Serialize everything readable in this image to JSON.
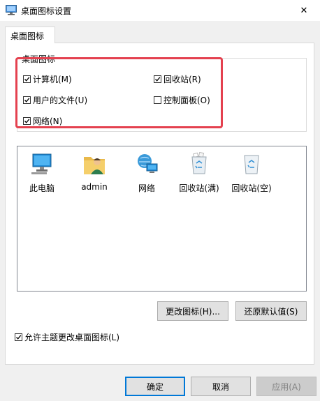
{
  "window": {
    "title": "桌面图标设置",
    "close_symbol": "✕"
  },
  "tab": {
    "label": "桌面图标"
  },
  "desktop_icons": {
    "legend": "桌面图标",
    "items": [
      {
        "label": "计算机(M)",
        "checked": true
      },
      {
        "label": "回收站(R)",
        "checked": true
      },
      {
        "label": "用户的文件(U)",
        "checked": true
      },
      {
        "label": "控制面板(O)",
        "checked": false
      },
      {
        "label": "网络(N)",
        "checked": true
      }
    ]
  },
  "icon_list": [
    {
      "label": "此电脑",
      "icon": "computer-icon"
    },
    {
      "label": "admin",
      "icon": "user-folder-icon"
    },
    {
      "label": "网络",
      "icon": "network-icon"
    },
    {
      "label": "回收站(满)",
      "icon": "recycle-bin-full-icon"
    },
    {
      "label": "回收站(空)",
      "icon": "recycle-bin-empty-icon"
    }
  ],
  "actions": {
    "change_icon": "更改图标(H)...",
    "restore_default": "还原默认值(S)"
  },
  "allow_themes": {
    "label": "允许主题更改桌面图标(L)",
    "checked": true
  },
  "footer": {
    "ok": "确定",
    "cancel": "取消",
    "apply": "应用(A)"
  },
  "colors": {
    "accent": "#0078d7",
    "highlight": "#e4414f"
  }
}
